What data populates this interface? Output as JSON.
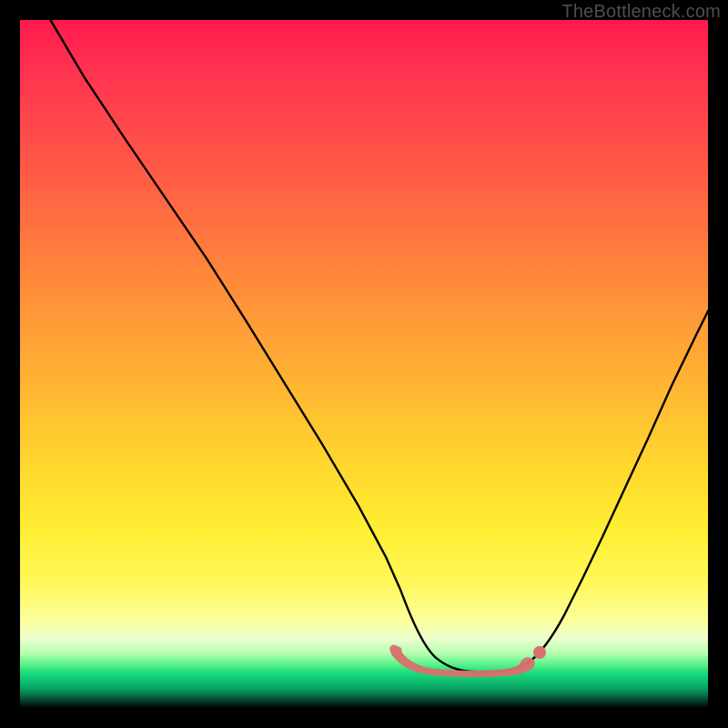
{
  "watermark": "TheBottleneck.com",
  "colors": {
    "frame": "#000000",
    "curve": "#000000",
    "highlight": "#d9716f",
    "gradient_top": "#ff1a4d",
    "gradient_mid": "#ffee33",
    "gradient_green": "#16d67a"
  },
  "chart_data": {
    "type": "line",
    "title": "",
    "xlabel": "",
    "ylabel": "",
    "xlim": [
      0,
      100
    ],
    "ylim": [
      0,
      100
    ],
    "series": [
      {
        "name": "bottleneck-curve",
        "x": [
          0,
          5,
          10,
          15,
          20,
          25,
          30,
          35,
          40,
          45,
          50,
          52,
          55,
          58,
          60,
          63,
          66,
          69,
          72,
          75,
          78,
          82,
          86,
          90,
          94,
          98,
          100
        ],
        "values": [
          100,
          92,
          83,
          75,
          66,
          57,
          49,
          40,
          31,
          22,
          13,
          10,
          6,
          4,
          3,
          2.2,
          2,
          2,
          2.2,
          3,
          5,
          8,
          14,
          22,
          33,
          45,
          52
        ]
      }
    ],
    "highlight_region": {
      "name": "optimal-zone",
      "x_start": 52,
      "x_end": 75,
      "approx_value": 2.3
    },
    "notes": "No axis ticks or numeric labels are visible in the image; x and y are normalized 0–100 estimates read from curve geometry."
  }
}
